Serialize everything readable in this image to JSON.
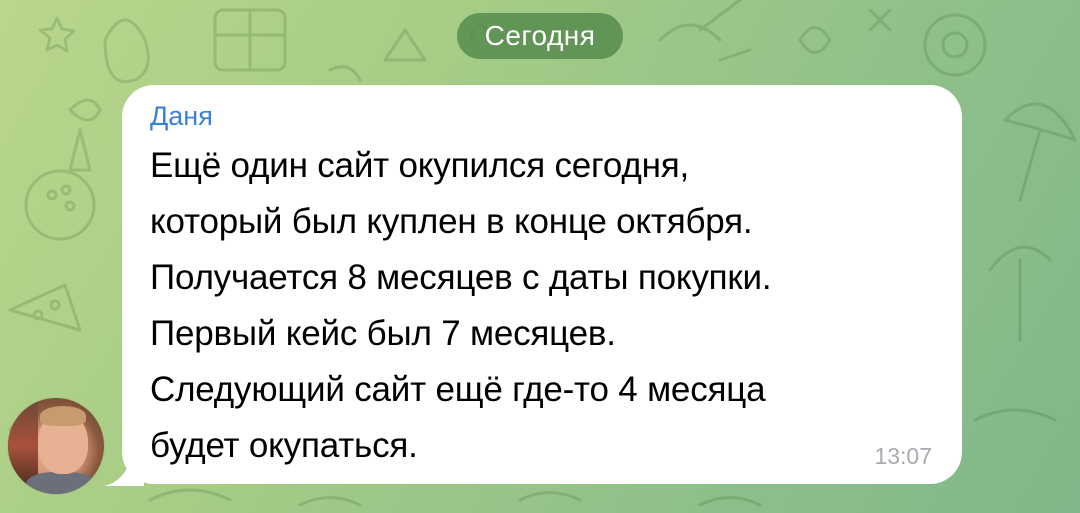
{
  "chat": {
    "date_label": "Сегодня",
    "background_color": "#a6cc86"
  },
  "message": {
    "sender": "Даня",
    "sender_color": "#3b82d6",
    "text": "Ещё один сайт окупился сегодня,\nкоторый был куплен в конце октября.\nПолучается 8 месяцев с даты покупки.\nПервый кейс был 7 месяцев.\nСледующий сайт ещё где-то 4 месяца\nбудет окупаться.",
    "time": "13:07",
    "avatar_icon": "user-avatar"
  }
}
